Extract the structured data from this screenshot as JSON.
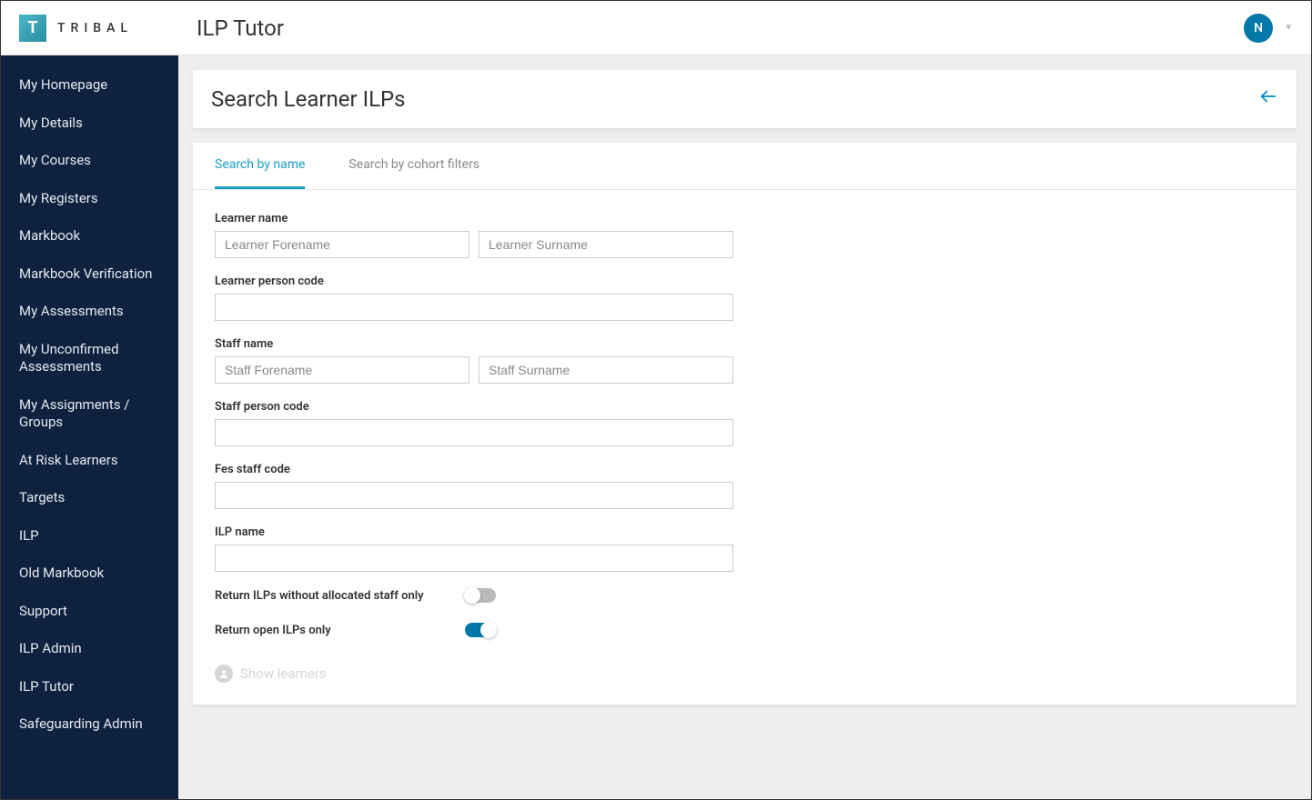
{
  "header": {
    "logo_letter": "T",
    "logo_text": "TRIBAL",
    "app_title": "ILP Tutor",
    "avatar_initial": "N"
  },
  "sidebar": {
    "items": [
      {
        "label": "My Homepage"
      },
      {
        "label": "My Details"
      },
      {
        "label": "My Courses"
      },
      {
        "label": "My Registers"
      },
      {
        "label": "Markbook"
      },
      {
        "label": "Markbook Verification"
      },
      {
        "label": "My Assessments"
      },
      {
        "label": "My Unconfirmed Assessments"
      },
      {
        "label": "My Assignments / Groups"
      },
      {
        "label": "At Risk Learners"
      },
      {
        "label": "Targets"
      },
      {
        "label": "ILP"
      },
      {
        "label": "Old Markbook"
      },
      {
        "label": "Support"
      },
      {
        "label": "ILP Admin"
      },
      {
        "label": "ILP Tutor"
      },
      {
        "label": "Safeguarding Admin"
      }
    ]
  },
  "page": {
    "title": "Search Learner ILPs"
  },
  "tabs": [
    {
      "label": "Search by name",
      "active": true
    },
    {
      "label": "Search by cohort filters",
      "active": false
    }
  ],
  "form": {
    "learner_name_label": "Learner name",
    "learner_forename_placeholder": "Learner Forename",
    "learner_surname_placeholder": "Learner Surname",
    "learner_person_code_label": "Learner person code",
    "staff_name_label": "Staff name",
    "staff_forename_placeholder": "Staff Forename",
    "staff_surname_placeholder": "Staff Surname",
    "staff_person_code_label": "Staff person code",
    "fes_staff_code_label": "Fes staff code",
    "ilp_name_label": "ILP name",
    "toggle_without_staff_label": "Return ILPs without allocated staff only",
    "toggle_open_only_label": "Return open ILPs only",
    "show_learners_label": "Show learners"
  }
}
